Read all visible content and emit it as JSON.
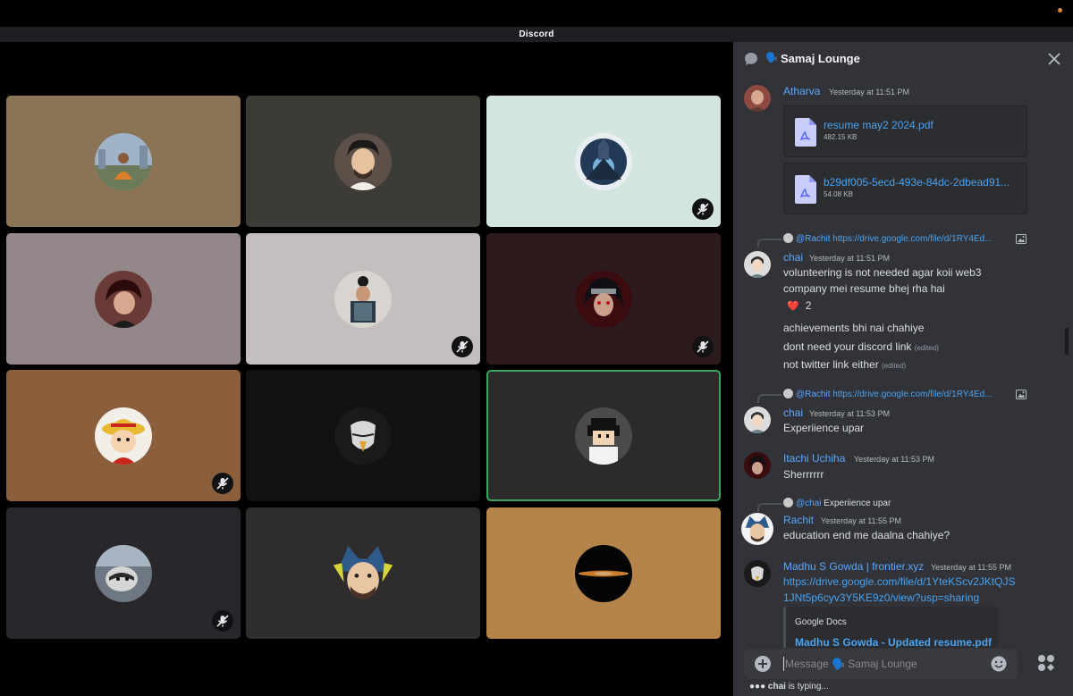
{
  "window": {
    "title": "Discord"
  },
  "colors": {
    "accent": "#5aa7ff",
    "link": "#4aa3f0",
    "speaking": "#3ba55d",
    "panel": "#313338"
  },
  "stage": {
    "tiles": [
      {
        "bg": "#8b7355",
        "avatar": "person-city-avatar",
        "muted": false,
        "speaking": false
      },
      {
        "bg": "#3c3b36",
        "avatar": "cartoon-man-avatar",
        "muted": false,
        "speaking": false
      },
      {
        "bg": "#d2e6df",
        "avatar": "anime-warrior-avatar",
        "muted": true,
        "speaking": false
      },
      {
        "bg": "#938789",
        "avatar": "anime-red-hair-avatar",
        "muted": false,
        "speaking": false
      },
      {
        "bg": "#c5bebe",
        "avatar": "person-book-avatar",
        "muted": true,
        "speaking": false
      },
      {
        "bg": "#2d1a1c",
        "avatar": "itachi-avatar",
        "muted": true,
        "speaking": false
      },
      {
        "bg": "#8b5e3c",
        "avatar": "luffy-avatar",
        "muted": true,
        "speaking": false
      },
      {
        "bg": "#111111",
        "avatar": "eagle-avatar",
        "muted": false,
        "speaking": false
      },
      {
        "bg": "#2a2b2a",
        "avatar": "pixel-boy-avatar",
        "muted": false,
        "speaking": true
      },
      {
        "bg": "#28282c",
        "avatar": "raccoon-avatar",
        "muted": true,
        "speaking": false
      },
      {
        "bg": "#2f2c2e",
        "avatar": "rachit-mascot-avatar",
        "muted": false,
        "speaking": false
      },
      {
        "bg": "#b5844a",
        "avatar": "eclipse-avatar",
        "muted": false,
        "speaking": false
      }
    ]
  },
  "chat": {
    "channel_emoji": "🗣️",
    "channel_name": "Samaj Lounge",
    "messages": [
      {
        "author": "Atharva",
        "time": "Yesterday at 11:51 PM",
        "files": [
          {
            "name": "resume may2 2024.pdf",
            "size": "482.15 KB"
          },
          {
            "name": "b29df005-5ecd-493e-84dc-2dbead91...",
            "size": "54.08 KB"
          }
        ]
      },
      {
        "reply_to": "@Rachit",
        "reply_text": "https://drive.google.com/file/d/1RY4Ed...",
        "author": "chai",
        "time": "Yesterday at 11:51 PM",
        "lines": [
          "volunteering is not needed agar koii web3",
          "company mei resume bhej rha hai"
        ],
        "reaction": {
          "emoji": "❤️",
          "count": "2"
        },
        "followups": [
          {
            "text": "achievements bhi nai chahiye",
            "edited": ""
          },
          {
            "text": "dont need your discord link",
            "edited": "(edited)"
          },
          {
            "text": "not twitter link either",
            "edited": "(edited)"
          }
        ]
      },
      {
        "reply_to": "@Rachit",
        "reply_text": "https://drive.google.com/file/d/1RY4Ed...",
        "author": "chai",
        "time": "Yesterday at 11:53 PM",
        "text": "Experiience upar"
      },
      {
        "author": "Itachi Uchiha",
        "time": "Yesterday at 11:53 PM",
        "text": "Sherrrrrr"
      },
      {
        "reply_to": "@chai",
        "reply_text": "Experiience upar",
        "author": "Rachit",
        "time": "Yesterday at 11:55 PM",
        "text": "education end me daalna chahiye?"
      },
      {
        "author": "Madhu S Gowda | frontier.xyz",
        "time": "Yesterday at 11:55 PM",
        "link_line1": "https://drive.google.com/file/d/1YteKScv2JKtQJS",
        "link_line2": "1JNt5p6cyv3Y5KE9z0/view?usp=sharing",
        "embed": {
          "provider": "Google Docs",
          "title": "Madhu S Gowda - Updated resume.pdf"
        }
      }
    ],
    "composer": {
      "placeholder": "Message 🗣️ Samaj Lounge"
    },
    "typing": {
      "user": "chai",
      "suffix": "is typing..."
    }
  }
}
